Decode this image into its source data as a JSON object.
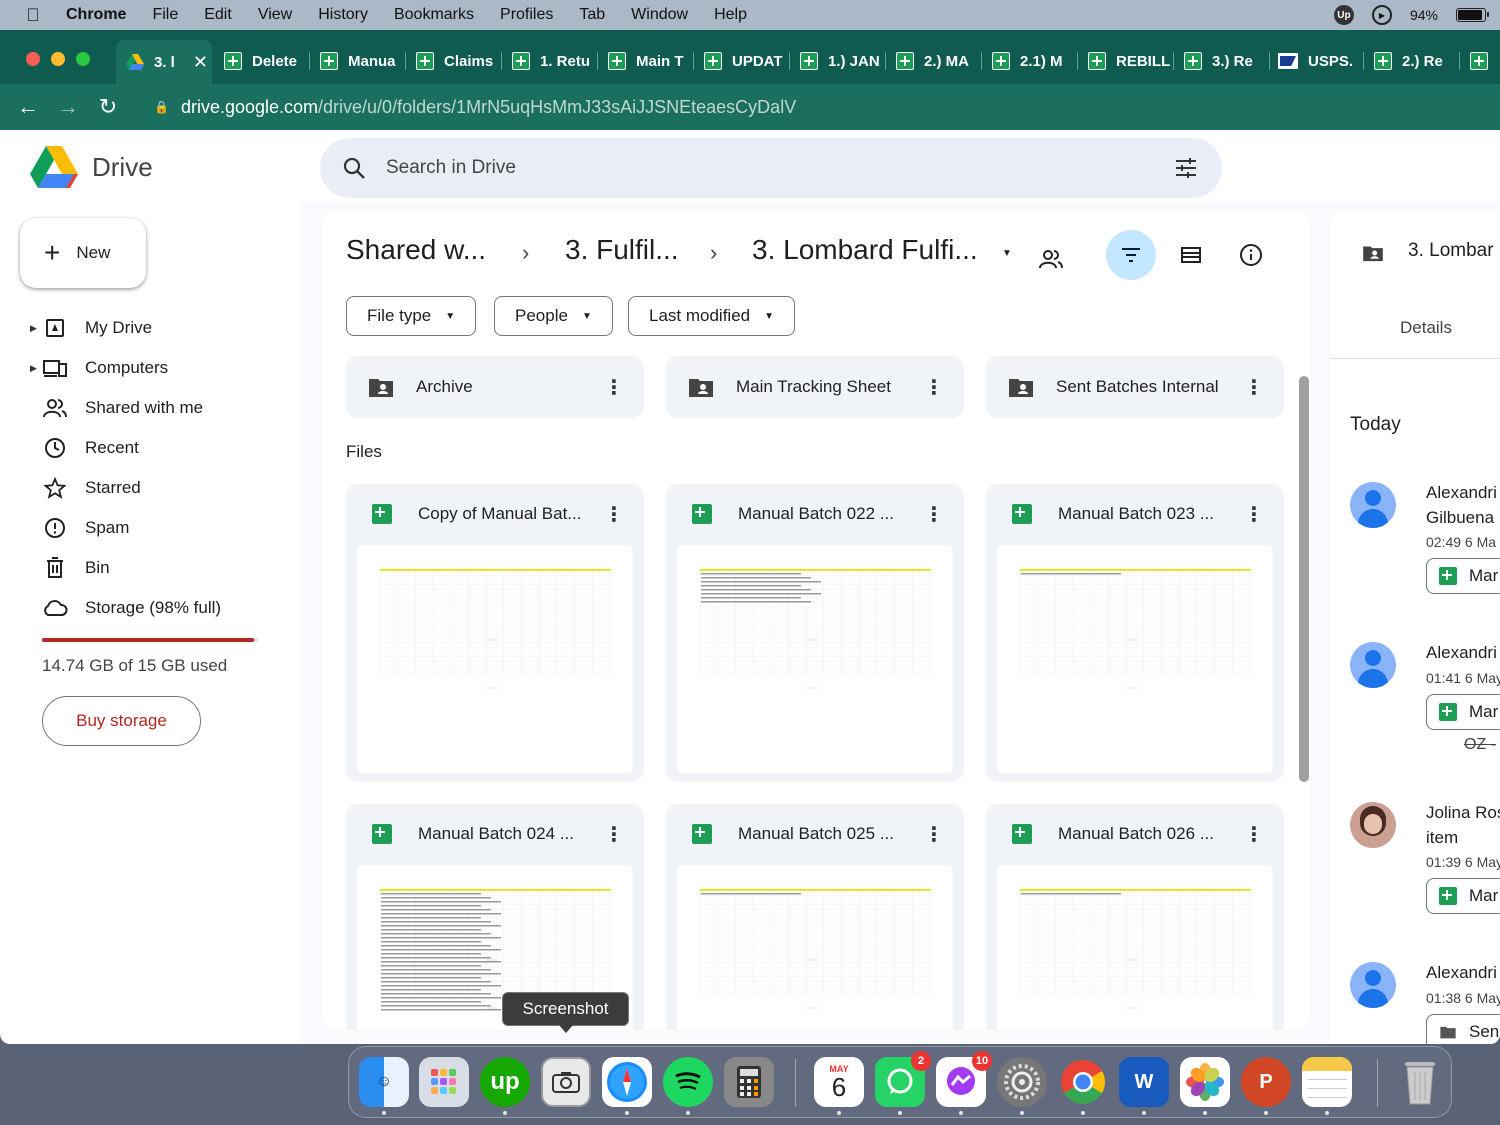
{
  "menubar": {
    "app_name": "Chrome",
    "items": [
      "File",
      "Edit",
      "View",
      "History",
      "Bookmarks",
      "Profiles",
      "Tab",
      "Window",
      "Help"
    ],
    "upwork_label": "Up",
    "battery": "94%"
  },
  "tabs": [
    {
      "label": "3. l",
      "icon": "drive-icon",
      "active": true
    },
    {
      "label": "Delete",
      "icon": "sheets-icon"
    },
    {
      "label": "Manua",
      "icon": "sheets-icon"
    },
    {
      "label": "Claims",
      "icon": "sheets-icon"
    },
    {
      "label": "1. Retu",
      "icon": "sheets-icon"
    },
    {
      "label": "Main T",
      "icon": "sheets-icon"
    },
    {
      "label": "UPDAT",
      "icon": "sheets-icon"
    },
    {
      "label": "1.) JAN",
      "icon": "sheets-icon"
    },
    {
      "label": "2.) MA",
      "icon": "sheets-icon"
    },
    {
      "label": "2.1) M",
      "icon": "sheets-icon"
    },
    {
      "label": "REBILL",
      "icon": "sheets-icon"
    },
    {
      "label": "3.) Re",
      "icon": "sheets-icon"
    },
    {
      "label": "USPS.",
      "icon": "usps-icon"
    },
    {
      "label": "2.) Re",
      "icon": "sheets-icon"
    }
  ],
  "address": {
    "host": "drive.google.com",
    "path": "/drive/u/0/folders/1MrN5uqHsMmJ33sAiJJSNEteaesCyDalV"
  },
  "drive": {
    "product_name": "Drive",
    "search_placeholder": "Search in Drive"
  },
  "sidebar": {
    "new_label": "New",
    "items": [
      {
        "label": "My Drive",
        "icon": "my-drive-icon"
      },
      {
        "label": "Computers",
        "icon": "computers-icon"
      },
      {
        "label": "Shared with me",
        "icon": "shared-icon"
      },
      {
        "label": "Recent",
        "icon": "clock-icon"
      },
      {
        "label": "Starred",
        "icon": "star-icon"
      },
      {
        "label": "Spam",
        "icon": "spam-icon"
      },
      {
        "label": "Bin",
        "icon": "bin-icon"
      },
      {
        "label": "Storage (98% full)",
        "icon": "cloud-icon"
      }
    ],
    "storage_fraction": 0.98,
    "storage_used": "14.74 GB of 15 GB used",
    "buy_storage": "Buy storage"
  },
  "breadcrumb": [
    "Shared w...",
    "3. Fulfil...",
    "3. Lombard Fulfi..."
  ],
  "filters": [
    "File type",
    "People",
    "Last modified"
  ],
  "folders": [
    "Archive",
    "Main Tracking Sheet",
    "Sent Batches Internal"
  ],
  "files_label": "Files",
  "files": [
    "Copy of Manual Bat...",
    "Manual Batch 022 ...",
    "Manual Batch 023 ...",
    "Manual Batch 024 ...",
    "Manual Batch 025 ...",
    "Manual Batch 026 ..."
  ],
  "activity_panel": {
    "title": "3. Lombar",
    "details_tab": "Details",
    "today": "Today",
    "entries": [
      {
        "who_line1": "Alexandri",
        "who_line2": "Gilbuena",
        "when": "02:49 6 Ma",
        "pill": "Mar",
        "pill_icon": "sheets-icon"
      },
      {
        "who_line1": "Alexandri",
        "who_line2": "",
        "when": "01:41 6 May",
        "pill": "Mar",
        "pill_icon": "sheets-icon",
        "strike": "OZ -"
      },
      {
        "who_line1": "Jolina Ros",
        "who_line2": "item",
        "when": "01:39 6 May",
        "pill": "Mar",
        "pill_icon": "sheets-icon"
      },
      {
        "who_line1": "Alexandri",
        "who_line2": "",
        "when": "01:38 6 May",
        "pill": "Sen",
        "pill_icon": "folder-icon"
      }
    ]
  },
  "tooltip": "Screenshot",
  "dock": {
    "calendar_month": "MAY",
    "calendar_day": "6",
    "whatsapp_badge": "2",
    "messenger_badge": "10",
    "upwork_label": "up",
    "word_label": "W",
    "powerpoint_label": "P"
  }
}
